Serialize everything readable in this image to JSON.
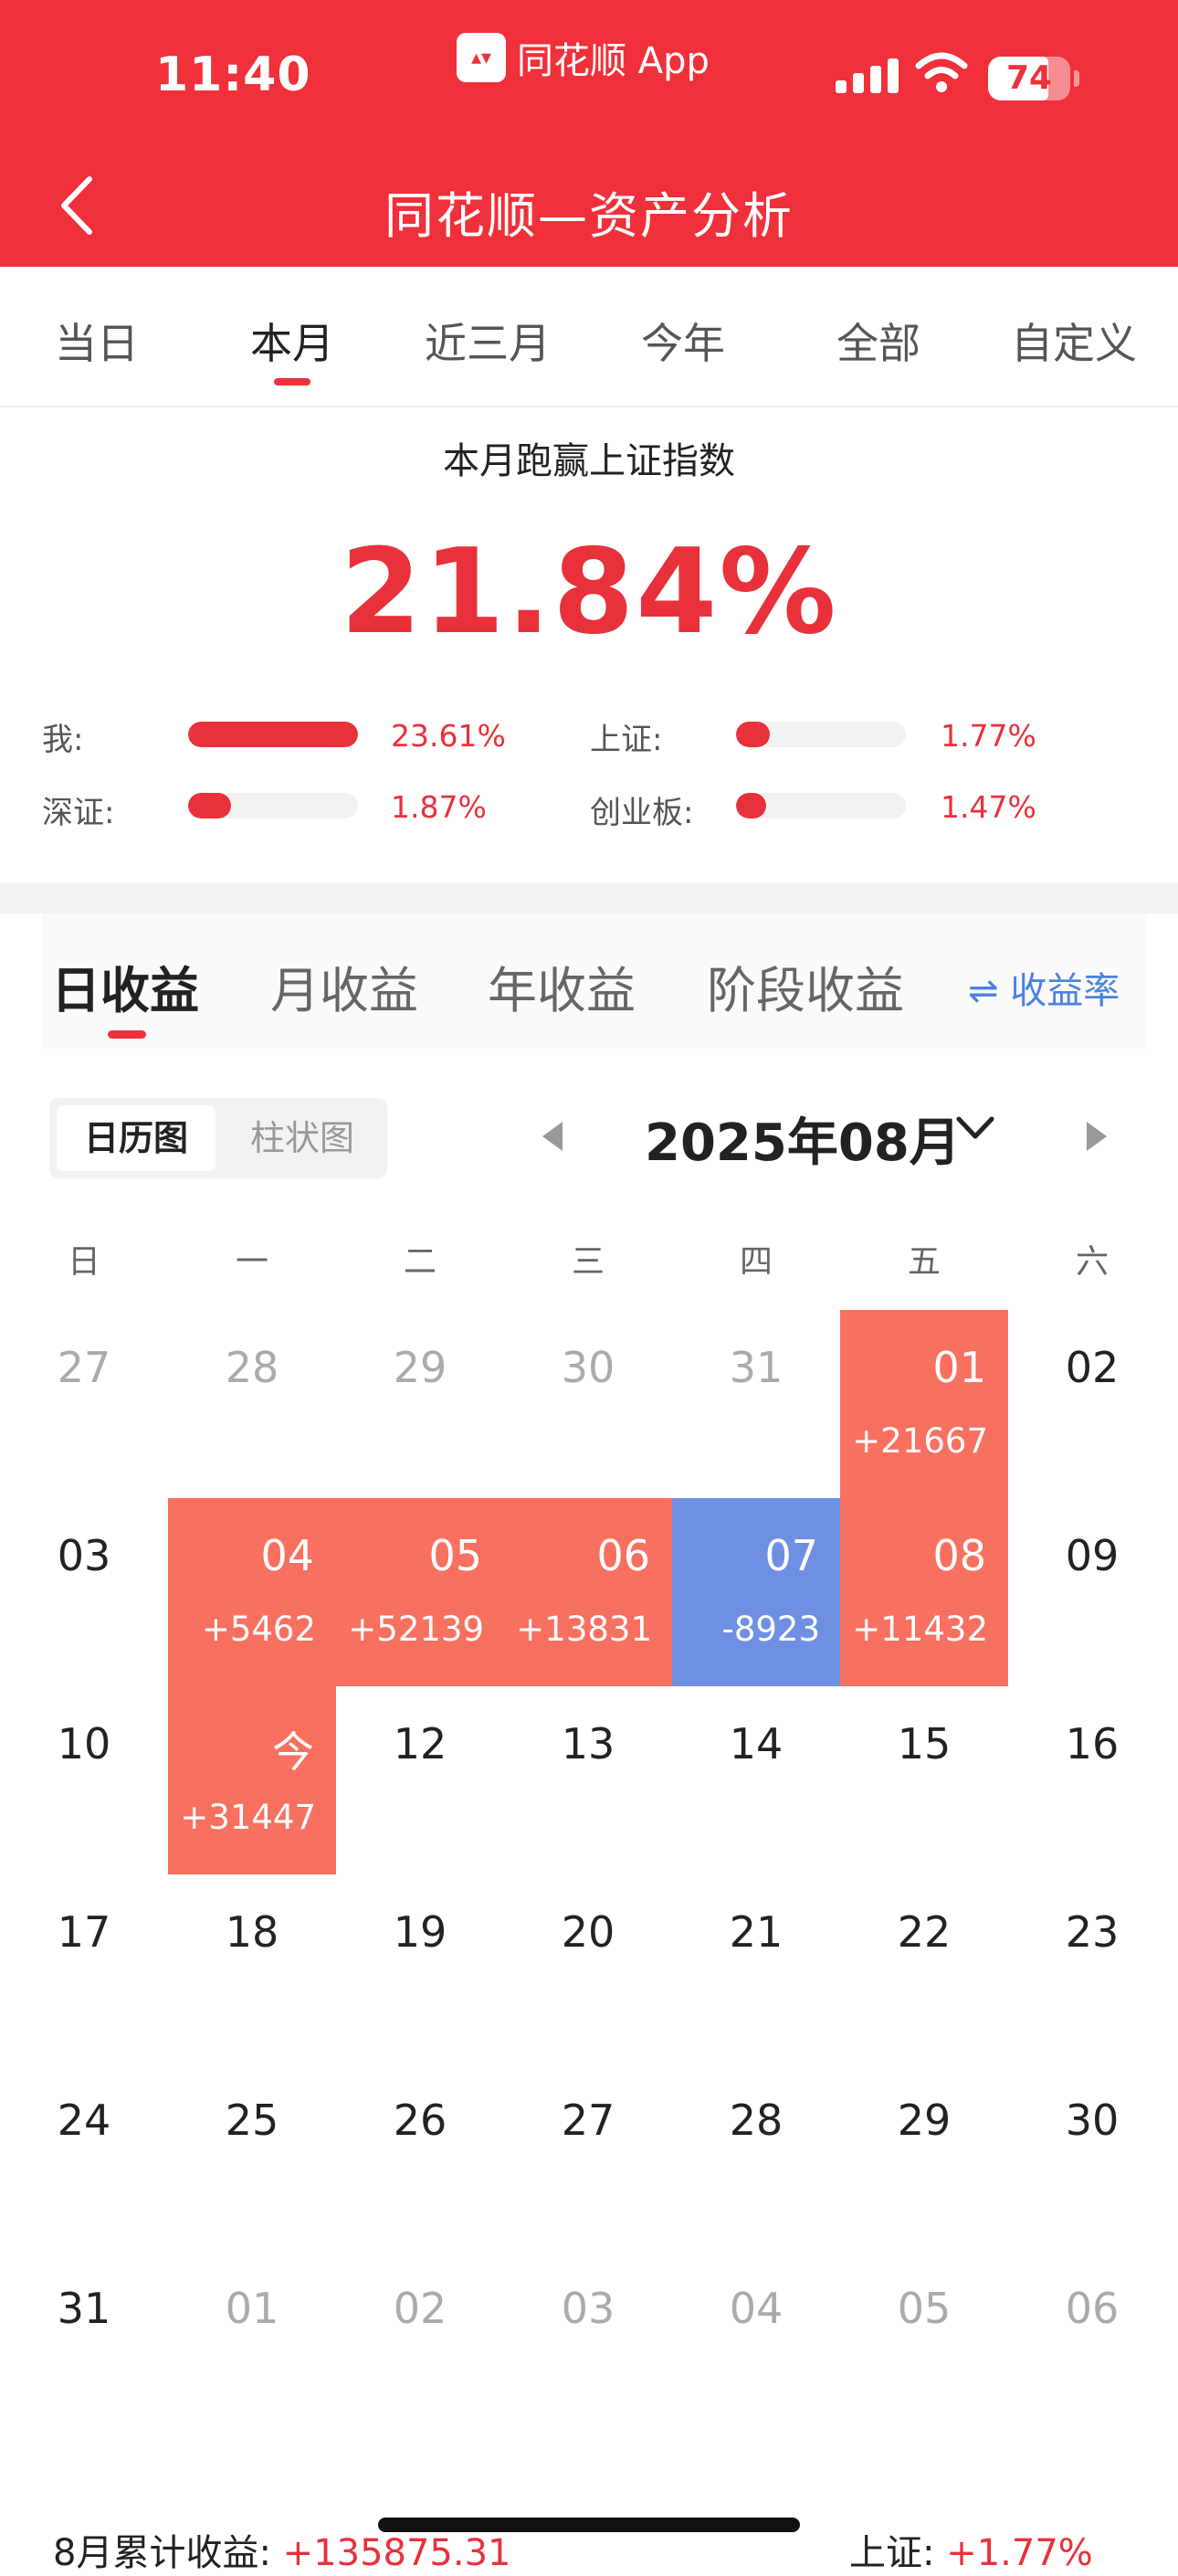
{
  "status_bar": {
    "time": "11:40",
    "app_name": "同花顺 App",
    "battery": "74",
    "icons": [
      "signal-icon",
      "wifi-icon",
      "battery-icon"
    ]
  },
  "header": {
    "title": "同花顺—资产分析",
    "back_icon": "chevron-left-icon",
    "bg_color": "#F0303A"
  },
  "period_tabs": [
    {
      "label": "当日",
      "active": false
    },
    {
      "label": "本月",
      "active": true
    },
    {
      "label": "近三月",
      "active": false
    },
    {
      "label": "今年",
      "active": false
    },
    {
      "label": "全部",
      "active": false
    },
    {
      "label": "自定义",
      "active": false
    }
  ],
  "summary": {
    "label": "本月跑赢上证指数",
    "value": "21.84%",
    "comparisons": [
      {
        "label": "我:",
        "value": "23.61%",
        "level": 1.0
      },
      {
        "label": "上证:",
        "value": "1.77%",
        "level": 0.2
      },
      {
        "label": "深证:",
        "value": "1.87%",
        "level": 0.25
      },
      {
        "label": "创业板:",
        "value": "1.47%",
        "level": 0.18
      }
    ]
  },
  "earnings_tabs": [
    {
      "label": "日收益",
      "active": true
    },
    {
      "label": "月收益",
      "active": false
    },
    {
      "label": "年收益",
      "active": false
    },
    {
      "label": "阶段收益",
      "active": false
    }
  ],
  "rate_toggle": {
    "icon": "swap-icon",
    "label": "收益率"
  },
  "view_toggle": {
    "calendar": "日历图",
    "bar": "柱状图",
    "selected": "日历图"
  },
  "month_selector": {
    "label": "2025年08月",
    "icons": [
      "triangle-left-icon",
      "chevron-down-icon",
      "triangle-right-icon"
    ]
  },
  "weekdays": [
    "日",
    "一",
    "二",
    "三",
    "四",
    "五",
    "六"
  ],
  "calendar": [
    [
      {
        "d": "27",
        "t": "gray"
      },
      {
        "d": "28",
        "t": "gray"
      },
      {
        "d": "29",
        "t": "gray"
      },
      {
        "d": "30",
        "t": "gray"
      },
      {
        "d": "31",
        "t": "gray"
      },
      {
        "d": "01",
        "t": "pos",
        "amt": "+21667"
      },
      {
        "d": "02",
        "t": "plain"
      }
    ],
    [
      {
        "d": "03",
        "t": "plain"
      },
      {
        "d": "04",
        "t": "pos",
        "amt": "+5462"
      },
      {
        "d": "05",
        "t": "pos",
        "amt": "+52139"
      },
      {
        "d": "06",
        "t": "pos",
        "amt": "+13831"
      },
      {
        "d": "07",
        "t": "neg",
        "amt": "-8923"
      },
      {
        "d": "08",
        "t": "pos",
        "amt": "+11432"
      },
      {
        "d": "09",
        "t": "plain"
      }
    ],
    [
      {
        "d": "10",
        "t": "plain"
      },
      {
        "d": "今",
        "t": "pos",
        "amt": "+31447"
      },
      {
        "d": "12",
        "t": "plain"
      },
      {
        "d": "13",
        "t": "plain"
      },
      {
        "d": "14",
        "t": "plain"
      },
      {
        "d": "15",
        "t": "plain"
      },
      {
        "d": "16",
        "t": "plain"
      }
    ],
    [
      {
        "d": "17",
        "t": "plain"
      },
      {
        "d": "18",
        "t": "plain"
      },
      {
        "d": "19",
        "t": "plain"
      },
      {
        "d": "20",
        "t": "plain"
      },
      {
        "d": "21",
        "t": "plain"
      },
      {
        "d": "22",
        "t": "plain"
      },
      {
        "d": "23",
        "t": "plain"
      }
    ],
    [
      {
        "d": "24",
        "t": "plain"
      },
      {
        "d": "25",
        "t": "plain"
      },
      {
        "d": "26",
        "t": "plain"
      },
      {
        "d": "27",
        "t": "plain"
      },
      {
        "d": "28",
        "t": "plain"
      },
      {
        "d": "29",
        "t": "plain"
      },
      {
        "d": "30",
        "t": "plain"
      }
    ],
    [
      {
        "d": "31",
        "t": "plain"
      },
      {
        "d": "01",
        "t": "gray"
      },
      {
        "d": "02",
        "t": "gray"
      },
      {
        "d": "03",
        "t": "gray"
      },
      {
        "d": "04",
        "t": "gray"
      },
      {
        "d": "05",
        "t": "gray"
      },
      {
        "d": "06",
        "t": "gray"
      }
    ]
  ],
  "footer": {
    "month_label": "8月累计收益:",
    "month_value": "+135875.31",
    "index_label": "上证:",
    "index_value": "+1.77%"
  },
  "colors": {
    "up": "#F87060",
    "down": "#6F8FE3",
    "accent": "#E8313B",
    "link": "#4A82E0"
  }
}
